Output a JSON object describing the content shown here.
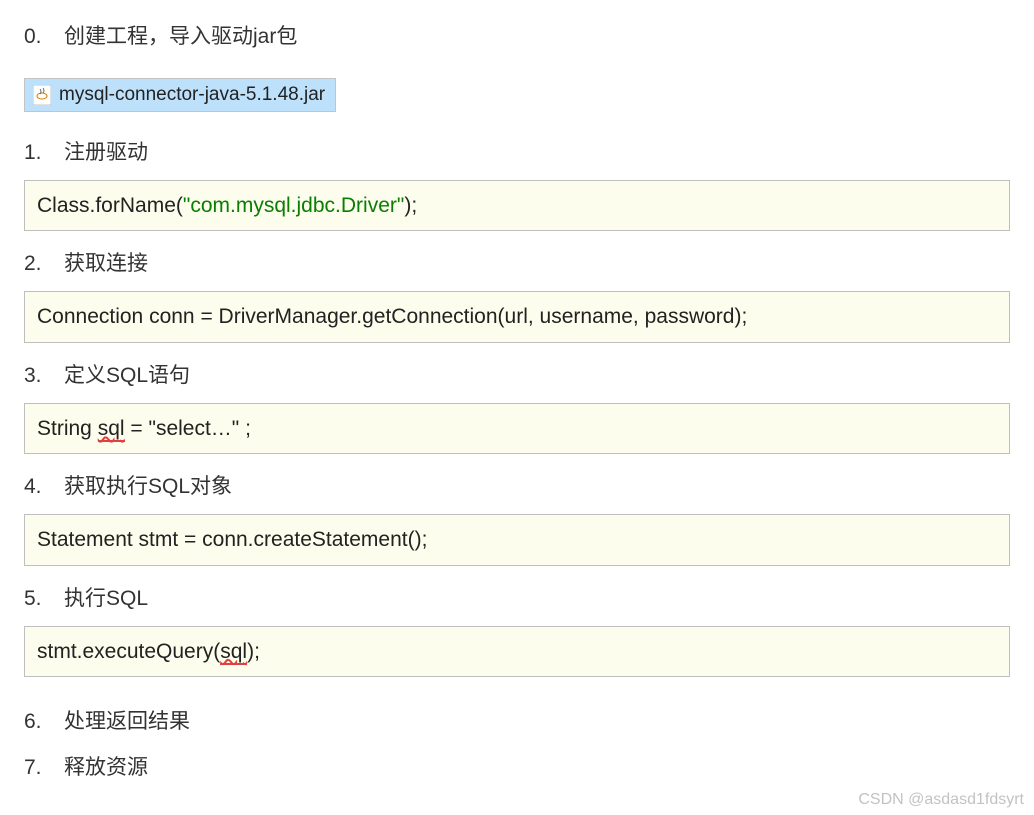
{
  "steps": [
    {
      "num": "0.",
      "title": "创建工程，导入驱动jar包"
    },
    {
      "num": "1.",
      "title": "注册驱动"
    },
    {
      "num": "2.",
      "title": "获取连接"
    },
    {
      "num": "3.",
      "title": "定义SQL语句"
    },
    {
      "num": "4.",
      "title": "获取执行SQL对象"
    },
    {
      "num": "5.",
      "title": "执行SQL"
    },
    {
      "num": "6.",
      "title": "处理返回结果"
    },
    {
      "num": "7.",
      "title": "释放资源"
    }
  ],
  "file": {
    "name": "mysql-connector-java-5.1.48.jar"
  },
  "code": {
    "step1_prefix": "Class.forName(",
    "step1_string": "\"com.mysql.jdbc.Driver\"",
    "step1_suffix": ");",
    "step2": "Connection conn = DriverManager.getConnection(url, username, password);",
    "step3_prefix": "String ",
    "step3_sql": "sql",
    "step3_suffix": " =  \"select…\" ;",
    "step4": "Statement stmt = conn.createStatement();",
    "step5_prefix": "stmt.executeQuery(",
    "step5_sql": "sql",
    "step5_suffix": ");"
  },
  "watermark": "CSDN @asdasd1fdsyrt"
}
